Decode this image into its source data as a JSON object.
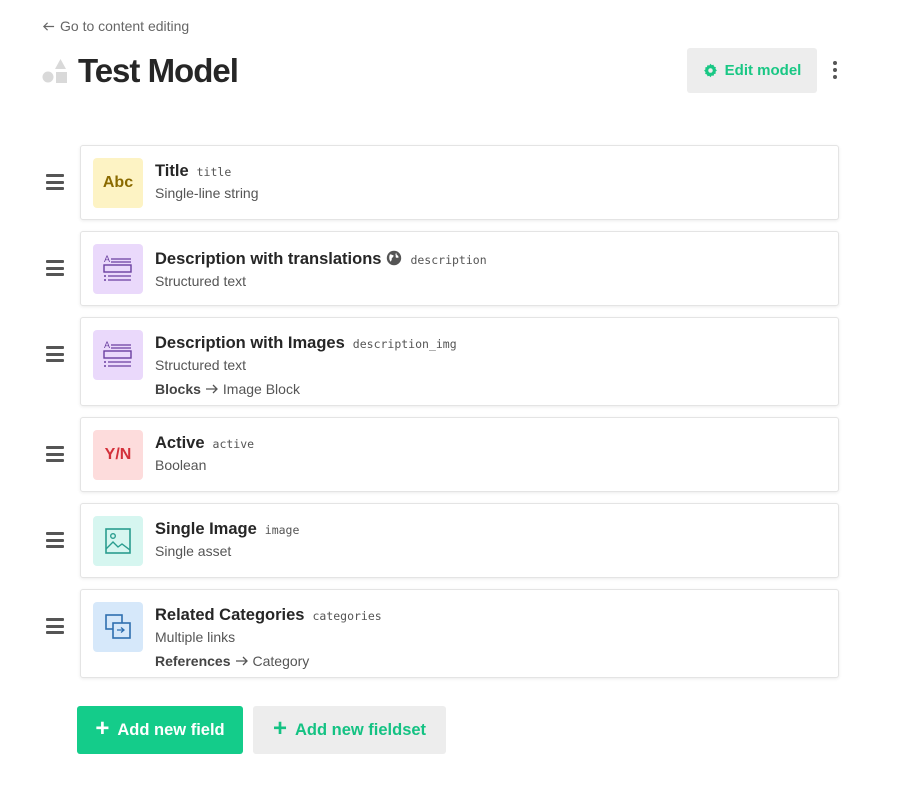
{
  "nav": {
    "back_label": "Go to content editing"
  },
  "header": {
    "title": "Test Model",
    "edit_label": "Edit model"
  },
  "fields": [
    {
      "label": "Title",
      "api_key": "title",
      "type": "Single-line string",
      "icon": "abc-text-icon",
      "icon_text": "Abc",
      "icon_bg": "#fdf3c4",
      "icon_color": "#8a6a00"
    },
    {
      "label": "Description with translations",
      "api_key": "description",
      "type": "Structured text",
      "icon": "structured-text-icon",
      "icon_bg": "#ead9fb",
      "localized": true
    },
    {
      "label": "Description with Images",
      "api_key": "description_img",
      "type": "Structured text",
      "icon": "structured-text-icon",
      "icon_bg": "#ead9fb",
      "extra_key": "Blocks",
      "extra_value": "Image Block"
    },
    {
      "label": "Active",
      "api_key": "active",
      "type": "Boolean",
      "icon": "boolean-icon",
      "icon_text": "Y/N",
      "icon_bg": "#fddcdc",
      "icon_color": "#d3303a"
    },
    {
      "label": "Single Image",
      "api_key": "image",
      "type": "Single asset",
      "icon": "image-icon",
      "icon_bg": "#d6f6f0"
    },
    {
      "label": "Related Categories",
      "api_key": "categories",
      "type": "Multiple links",
      "icon": "links-icon",
      "icon_bg": "#d6e8fa",
      "extra_key": "References",
      "extra_value": "Category"
    }
  ],
  "actions": {
    "add_field": "Add new field",
    "add_fieldset": "Add new fieldset"
  },
  "colors": {
    "accent": "#14cc8a",
    "secondary_bg": "#ededed"
  }
}
